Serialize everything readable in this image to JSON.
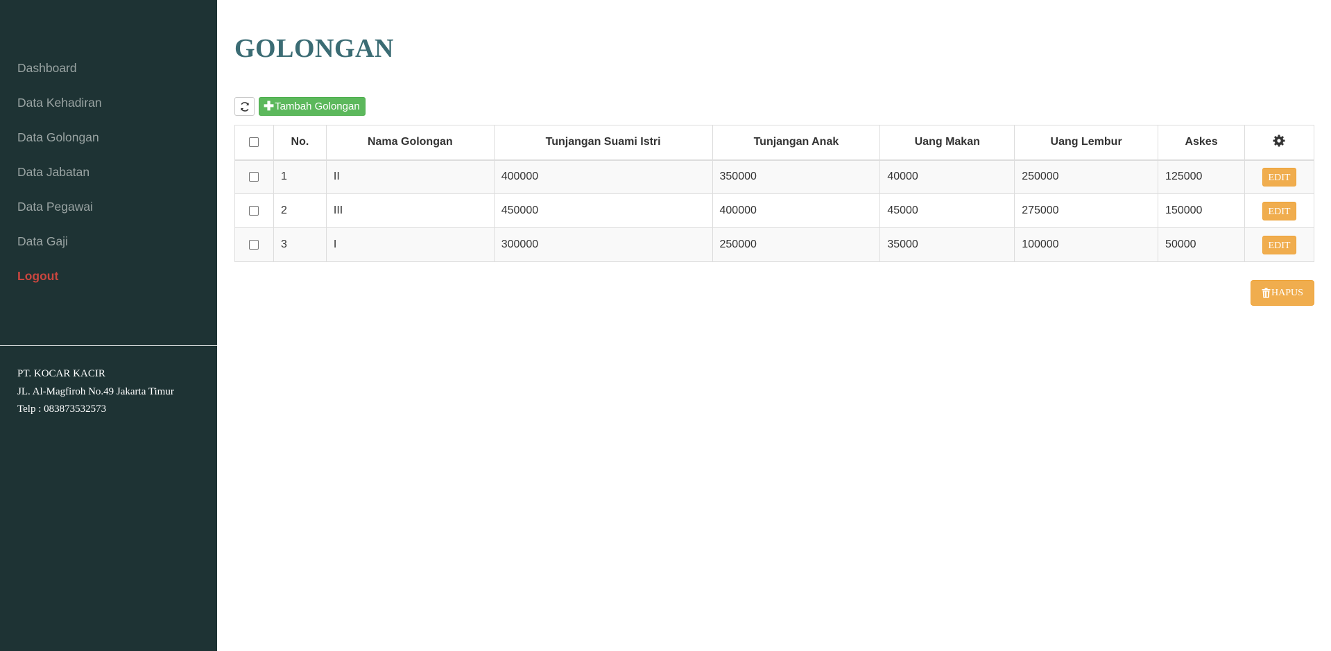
{
  "sidebar": {
    "items": [
      {
        "label": "Dashboard"
      },
      {
        "label": "Data Kehadiran"
      },
      {
        "label": "Data Golongan"
      },
      {
        "label": "Data Jabatan"
      },
      {
        "label": "Data Pegawai"
      },
      {
        "label": "Data Gaji"
      },
      {
        "label": "Logout"
      }
    ],
    "company": {
      "name": "PT. KOCAR KACIR",
      "address": "JL. Al-Magfiroh No.49 Jakarta Timur",
      "phone": "Telp : 083873532573"
    }
  },
  "page": {
    "title": "GOLONGAN"
  },
  "toolbar": {
    "refresh_icon": "refresh-icon",
    "add_label": "Tambah Golongan",
    "add_icon": "plus-icon"
  },
  "table": {
    "columns": [
      "No.",
      "Nama Golongan",
      "Tunjangan Suami Istri",
      "Tunjangan Anak",
      "Uang Makan",
      "Uang Lembur",
      "Askes"
    ],
    "settings_icon": "gear-icon",
    "rows": [
      {
        "no": "1",
        "nama": "II",
        "tunjangan_suami_istri": "400000",
        "tunjangan_anak": "350000",
        "uang_makan": "40000",
        "uang_lembur": "250000",
        "askes": "125000",
        "action": "EDIT"
      },
      {
        "no": "2",
        "nama": "III",
        "tunjangan_suami_istri": "450000",
        "tunjangan_anak": "400000",
        "uang_makan": "45000",
        "uang_lembur": "275000",
        "askes": "150000",
        "action": "EDIT"
      },
      {
        "no": "3",
        "nama": "I",
        "tunjangan_suami_istri": "300000",
        "tunjangan_anak": "250000",
        "uang_makan": "35000",
        "uang_lembur": "100000",
        "askes": "50000",
        "action": "EDIT"
      }
    ]
  },
  "hapus": {
    "label": "HAPUS",
    "icon": "trash-icon"
  },
  "colors": {
    "sidebar_bg": "#1e3334",
    "title": "#3b6c74",
    "logout": "#c9463f",
    "add_button": "#5cb85c",
    "edit_button": "#f0ad4e"
  }
}
